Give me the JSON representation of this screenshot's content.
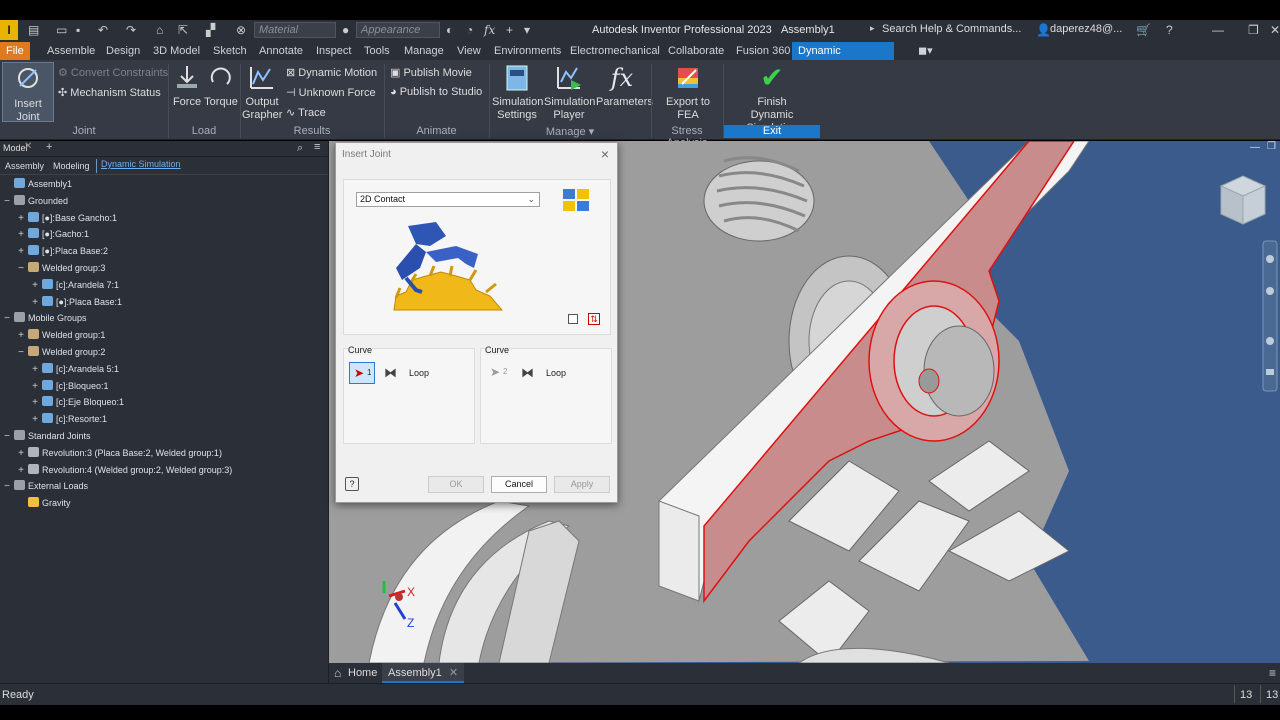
{
  "app": {
    "title": "Autodesk Inventor Professional 2023",
    "document": "Assembly1",
    "logo": "I"
  },
  "qat": {
    "material": "Material",
    "appearance": "Appearance",
    "search": "Search Help & Commands...",
    "user": "daperez48@..."
  },
  "tabs": [
    "File",
    "Assemble",
    "Design",
    "3D Model",
    "Sketch",
    "Annotate",
    "Inspect",
    "Tools",
    "Manage",
    "View",
    "Environments",
    "Electromechanical",
    "Collaborate",
    "Fusion 360",
    "Dynamic Simulation"
  ],
  "ribbon": {
    "insert_joint": "Insert Joint",
    "convert_constraints": "Convert Constraints",
    "mechanism_status": "Mechanism Status",
    "force": "Force",
    "torque": "Torque",
    "output_grapher": [
      "Output",
      "Grapher"
    ],
    "dynamic_motion": "Dynamic Motion",
    "unknown_force": "Unknown Force",
    "trace": "Trace",
    "publish_movie": "Publish Movie",
    "publish_studio": "Publish to Studio",
    "sim_settings": [
      "Simulation",
      "Settings"
    ],
    "sim_player": [
      "Simulation",
      "Player"
    ],
    "parameters": "Parameters",
    "export_fea": "Export to FEA",
    "finish": [
      "Finish",
      "Dynamic Simulation"
    ],
    "panels": {
      "joint": "Joint",
      "load": "Load",
      "results": "Results",
      "animate": "Animate",
      "manage": "Manage",
      "stress": "Stress Analysis",
      "exit": "Exit"
    }
  },
  "browser": {
    "title": "Model",
    "subtabs": [
      "Assembly",
      "Modeling",
      "Dynamic Simulation"
    ],
    "tree": [
      {
        "label": "Assembly1",
        "exp": "",
        "indent": 0,
        "color": "#6fa8dc"
      },
      {
        "label": "Grounded",
        "exp": "−",
        "indent": 0,
        "color": "#9aa0a8"
      },
      {
        "label": "[●]:Base Gancho:1",
        "exp": "+",
        "indent": 1,
        "color": "#6fa8dc"
      },
      {
        "label": "[●]:Gacho:1",
        "exp": "+",
        "indent": 1,
        "color": "#6fa8dc"
      },
      {
        "label": "[●]:Placa Base:2",
        "exp": "+",
        "indent": 1,
        "color": "#6fa8dc"
      },
      {
        "label": "Welded group:3",
        "exp": "−",
        "indent": 1,
        "color": "#c8a878"
      },
      {
        "label": "[c]:Arandela 7:1",
        "exp": "+",
        "indent": 2,
        "color": "#6fa8dc"
      },
      {
        "label": "[●]:Placa Base:1",
        "exp": "+",
        "indent": 2,
        "color": "#6fa8dc"
      },
      {
        "label": "Mobile Groups",
        "exp": "−",
        "indent": 0,
        "color": "#9aa0a8"
      },
      {
        "label": "Welded group:1",
        "exp": "+",
        "indent": 1,
        "color": "#c8a878"
      },
      {
        "label": "Welded group:2",
        "exp": "−",
        "indent": 1,
        "color": "#c8a878"
      },
      {
        "label": "[c]:Arandela 5:1",
        "exp": "+",
        "indent": 2,
        "color": "#6fa8dc"
      },
      {
        "label": "[c]:Bloqueo:1",
        "exp": "+",
        "indent": 2,
        "color": "#6fa8dc"
      },
      {
        "label": "[c]:Eje Bloqueo:1",
        "exp": "+",
        "indent": 2,
        "color": "#6fa8dc"
      },
      {
        "label": "[c]:Resorte:1",
        "exp": "+",
        "indent": 2,
        "color": "#6fa8dc"
      },
      {
        "label": "Standard Joints",
        "exp": "−",
        "indent": 0,
        "color": "#9aa0a8"
      },
      {
        "label": "Revolution:3 (Placa Base:2, Welded group:1)",
        "exp": "+",
        "indent": 1,
        "color": "#b0b5bd"
      },
      {
        "label": "Revolution:4 (Welded group:2, Welded group:3)",
        "exp": "+",
        "indent": 1,
        "color": "#b0b5bd"
      },
      {
        "label": "External Loads",
        "exp": "−",
        "indent": 0,
        "color": "#9aa0a8"
      },
      {
        "label": "Gravity",
        "exp": "",
        "indent": 1,
        "color": "#f0c040"
      }
    ]
  },
  "dialog": {
    "title": "Insert Joint",
    "joint_type": "2D Contact",
    "curve1_label": "Curve",
    "curve2_label": "Curve",
    "sel1": "1",
    "sel2": "2",
    "loop1": "Loop",
    "loop2": "Loop",
    "ok": "OK",
    "cancel": "Cancel",
    "apply": "Apply"
  },
  "doctabs": {
    "home": "Home",
    "doc": "Assembly1"
  },
  "status": {
    "text": "Ready",
    "n1": "13",
    "n2": "13"
  },
  "axes": {
    "x": "X",
    "z": "Z"
  }
}
